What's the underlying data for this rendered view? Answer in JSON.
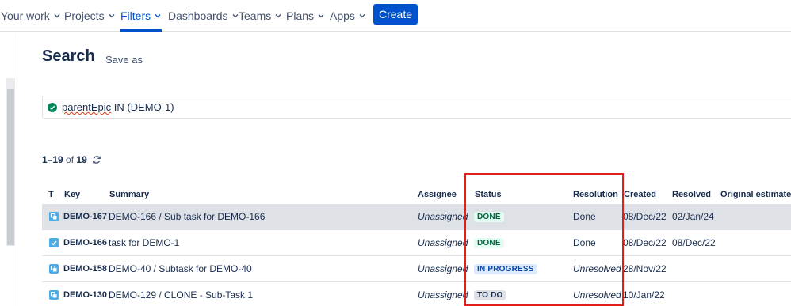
{
  "nav": {
    "items": [
      {
        "label": "Your work"
      },
      {
        "label": "Projects"
      },
      {
        "label": "Filters"
      },
      {
        "label": "Dashboards"
      },
      {
        "label": "Teams"
      },
      {
        "label": "Plans"
      },
      {
        "label": "Apps"
      }
    ],
    "create_label": "Create"
  },
  "page": {
    "title": "Search",
    "save_as": "Save as"
  },
  "jql": {
    "word": "parentEpic",
    "rest": " IN (DEMO-1)"
  },
  "results": {
    "range": "1–19",
    "of": " of ",
    "total": "19"
  },
  "table": {
    "headers": {
      "type": "T",
      "key": "Key",
      "summary": "Summary",
      "assignee": "Assignee",
      "status": "Status",
      "resolution": "Resolution",
      "created": "Created",
      "resolved": "Resolved",
      "original_estimate": "Original estimate"
    },
    "rows": [
      {
        "key": "DEMO-167",
        "summary": "DEMO-166 / Sub task for DEMO-166",
        "assignee": "Unassigned",
        "status": "DONE",
        "resolution": "Done",
        "created": "08/Dec/22",
        "resolved": "02/Jan/24"
      },
      {
        "key": "DEMO-166",
        "summary": "task for DEMO-1",
        "assignee": "Unassigned",
        "status": "DONE",
        "resolution": "Done",
        "created": "08/Dec/22",
        "resolved": "08/Dec/22"
      },
      {
        "key": "DEMO-158",
        "summary": "DEMO-40 / Subtask for DEMO-40",
        "assignee": "Unassigned",
        "status": "IN PROGRESS",
        "resolution": "Unresolved",
        "created": "28/Nov/22",
        "resolved": ""
      },
      {
        "key": "DEMO-130",
        "summary": "DEMO-129 / CLONE - Sub-Task 1",
        "assignee": "Unassigned",
        "status": "TO DO",
        "resolution": "Unresolved",
        "created": "10/Jan/22",
        "resolved": ""
      }
    ]
  },
  "colors": {
    "accent": "#0052cc",
    "highlight": "#e0211b",
    "done_bg": "#e3fcef",
    "done_fg": "#006644",
    "progress_bg": "#deebff",
    "progress_fg": "#0747a6"
  },
  "icons": {
    "subtask": "subtask-icon",
    "task": "task-icon",
    "valid": "check-circle-icon",
    "refresh": "refresh-icon",
    "chevron": "chevron-down-icon"
  }
}
